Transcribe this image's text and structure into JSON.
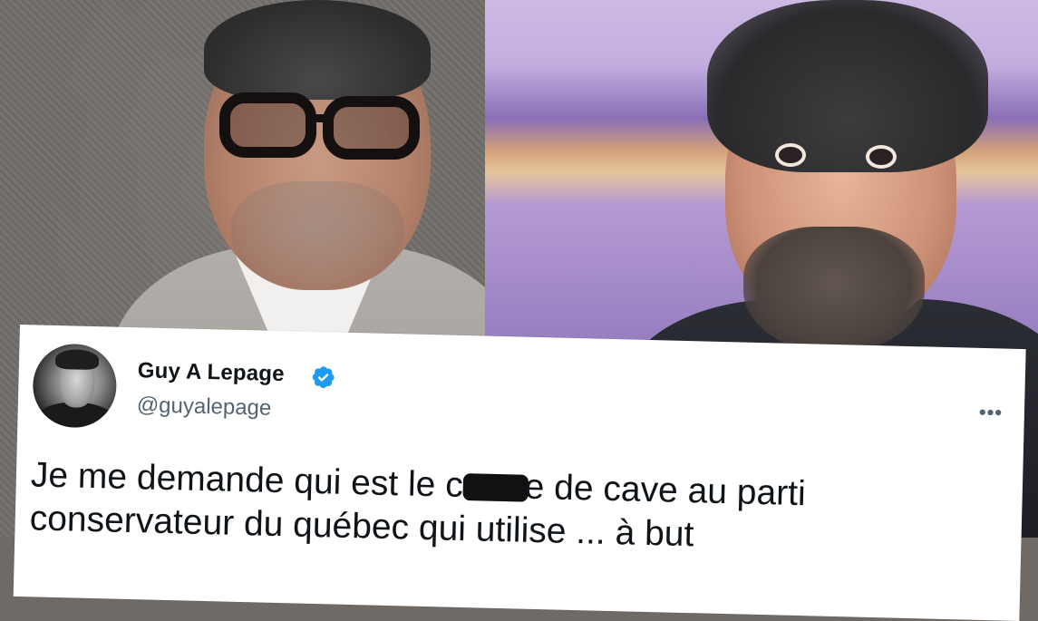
{
  "tweet": {
    "display_name": "Guy A Lepage",
    "handle": "@guyalepage",
    "verified": true,
    "text_line1_before": "Je me demande qui est le c",
    "text_line1_after": "e de cave au parti",
    "text_line2": "conservateur du québec qui utilise ... à but",
    "more_icon": "more-horizontal-icon",
    "verified_color": "#1d9bf0"
  }
}
